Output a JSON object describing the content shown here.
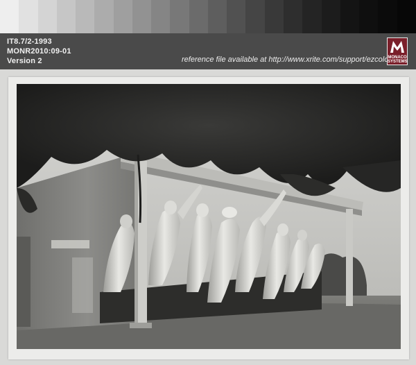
{
  "target": {
    "line1": "IT8.7/2-1993",
    "line2": "MONR2010:09-01",
    "line3": "Version 2",
    "reference": "reference file available at http://www.xrite.com/support/ezcolor",
    "logo_label": "MONACO\nSYSTEMS",
    "logo_color": "#7a1f2a"
  },
  "gray_patches": [
    "#eeeeee",
    "#e1e1e1",
    "#d4d4d4",
    "#c6c6c6",
    "#b9b9b9",
    "#acacac",
    "#9f9f9f",
    "#929292",
    "#858585",
    "#787878",
    "#6b6b6b",
    "#5e5e5e",
    "#515151",
    "#454545",
    "#393939",
    "#2e2e2e",
    "#242424",
    "#1c1c1c",
    "#141414",
    "#0f0f0f",
    "#0b0b0b",
    "#070707"
  ],
  "photo": {
    "subject": "porch-with-figurehead-statues"
  }
}
